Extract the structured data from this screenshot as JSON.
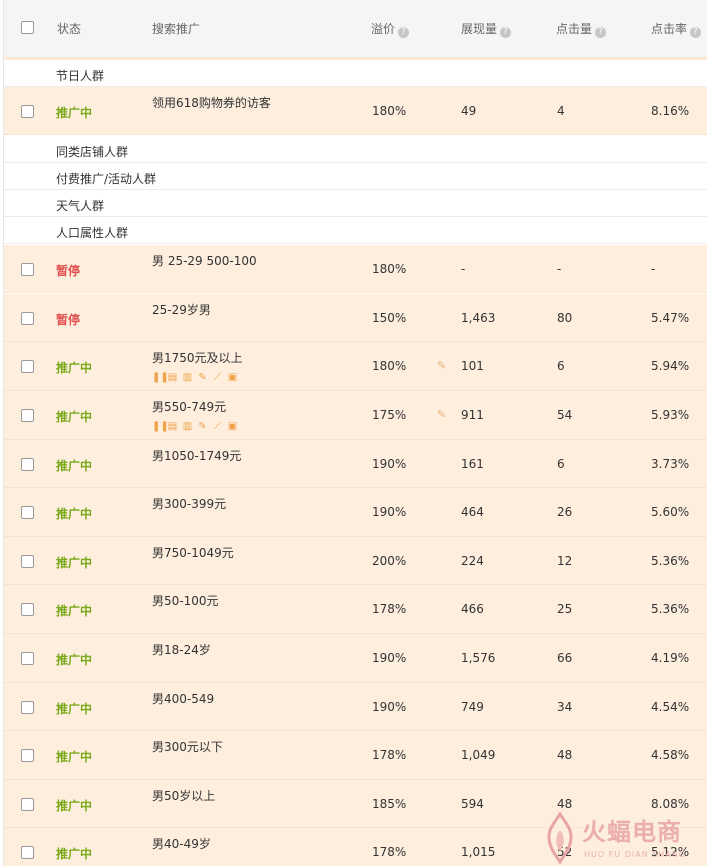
{
  "header": {
    "status": "状态",
    "search": "搜索推广",
    "premium": "溢价",
    "impressions": "展现量",
    "clicks": "点击量",
    "ctr": "点击率",
    "help_glyph": "?"
  },
  "groups": [
    "节日人群",
    "同类店铺人群",
    "付费推广/活动人群",
    "天气人群",
    "人口属性人群"
  ],
  "rows": [
    {
      "status": "推广中",
      "name": "领用618购物券的访客",
      "premium": "180%",
      "impressions": "49",
      "clicks": "4",
      "ctr": "8.16%"
    },
    {
      "status": "暂停",
      "name": "男 25-29 500-100",
      "premium": "180%",
      "impressions": "-",
      "clicks": "-",
      "ctr": "-"
    },
    {
      "status": "暂停",
      "name": "25-29岁男",
      "premium": "150%",
      "impressions": "1,463",
      "clicks": "80",
      "ctr": "5.47%"
    },
    {
      "status": "推广中",
      "name": "男1750元及以上",
      "premium": "180%",
      "impressions": "101",
      "clicks": "6",
      "ctr": "5.94%"
    },
    {
      "status": "推广中",
      "name": "男550-749元",
      "premium": "175%",
      "impressions": "911",
      "clicks": "54",
      "ctr": "5.93%"
    },
    {
      "status": "推广中",
      "name": "男1050-1749元",
      "premium": "190%",
      "impressions": "161",
      "clicks": "6",
      "ctr": "3.73%"
    },
    {
      "status": "推广中",
      "name": "男300-399元",
      "premium": "190%",
      "impressions": "464",
      "clicks": "26",
      "ctr": "5.60%"
    },
    {
      "status": "推广中",
      "name": "男750-1049元",
      "premium": "200%",
      "impressions": "224",
      "clicks": "12",
      "ctr": "5.36%"
    },
    {
      "status": "推广中",
      "name": "男50-100元",
      "premium": "178%",
      "impressions": "466",
      "clicks": "25",
      "ctr": "5.36%"
    },
    {
      "status": "推广中",
      "name": "男18-24岁",
      "premium": "190%",
      "impressions": "1,576",
      "clicks": "66",
      "ctr": "4.19%"
    },
    {
      "status": "推广中",
      "name": "男400-549",
      "premium": "190%",
      "impressions": "749",
      "clicks": "34",
      "ctr": "4.54%"
    },
    {
      "status": "推广中",
      "name": "男300元以下",
      "premium": "178%",
      "impressions": "1,049",
      "clicks": "48",
      "ctr": "4.58%"
    },
    {
      "status": "推广中",
      "name": "男50岁以上",
      "premium": "185%",
      "impressions": "594",
      "clicks": "48",
      "ctr": "8.08%"
    },
    {
      "status": "推广中",
      "name": "男40-49岁",
      "premium": "178%",
      "impressions": "1,015",
      "clicks": "52",
      "ctr": "5.12%"
    }
  ],
  "watermark": {
    "title": "火蝠电商",
    "sub": "HUO FU DIAN SHANG"
  },
  "colors": {
    "active": "#7aa91a",
    "paused": "#e0504f",
    "row_bg": "#fdeede",
    "icon": "#f0a24a"
  }
}
